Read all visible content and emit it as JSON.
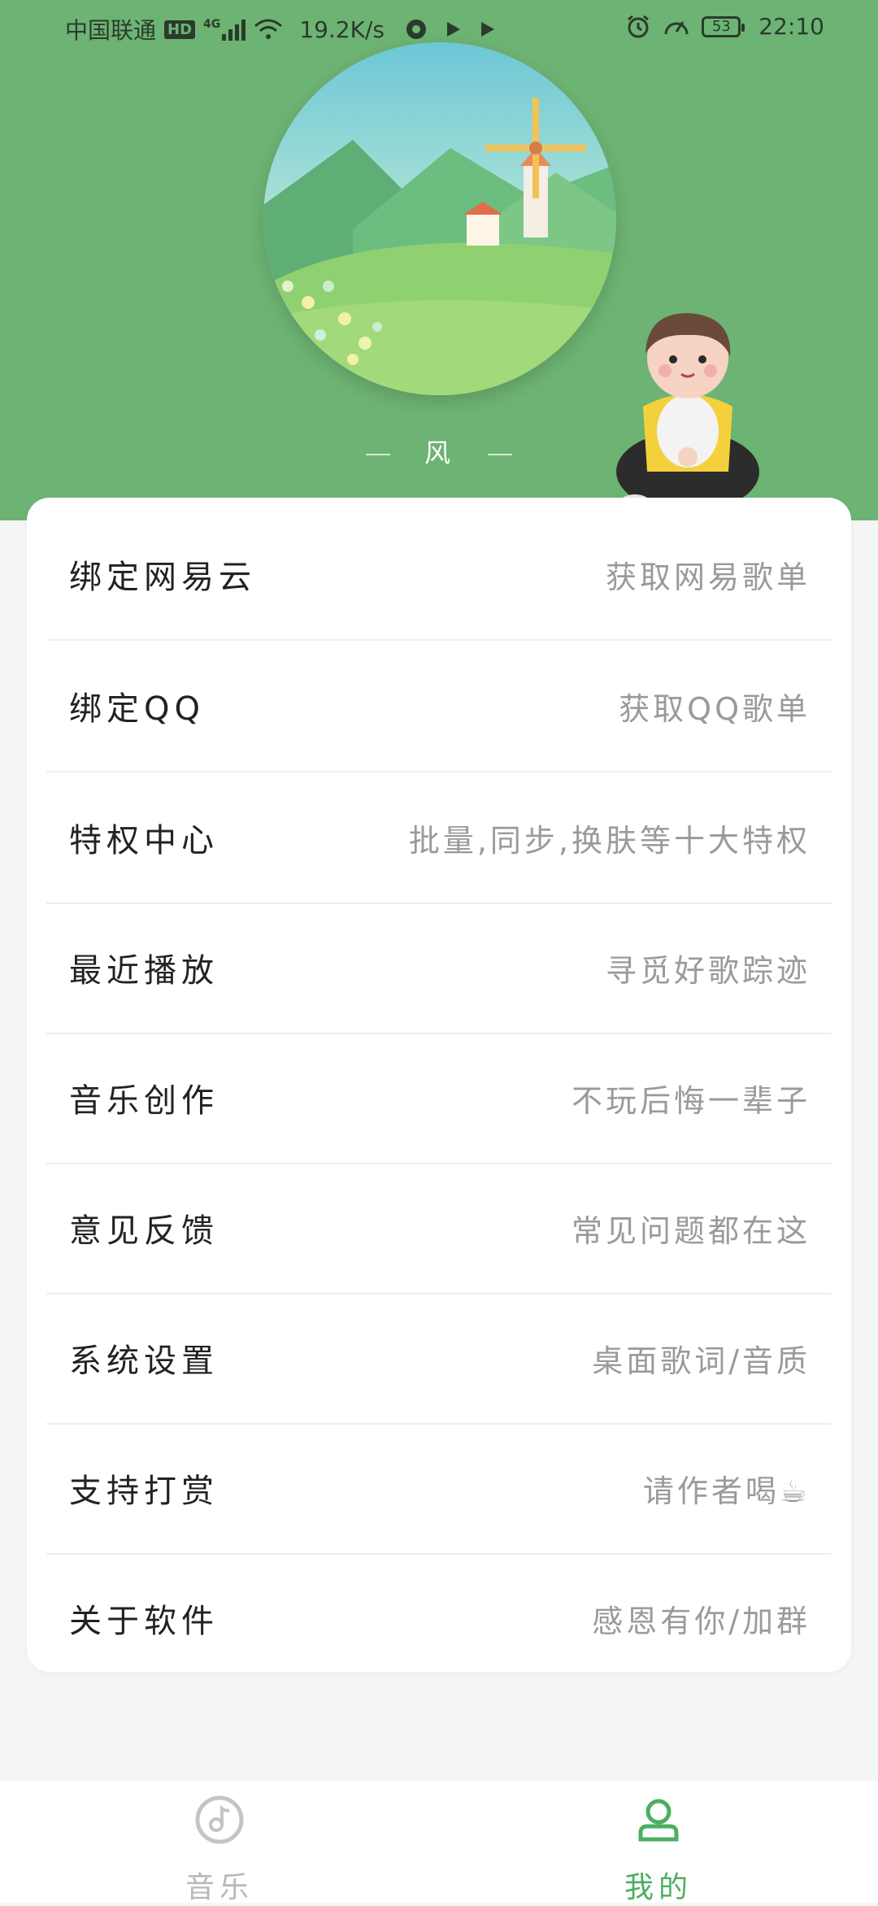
{
  "status_bar": {
    "carrier": "中国联通",
    "hd": "HD",
    "network": "4G",
    "speed": "19.2K/s",
    "battery": "53",
    "time": "22:10"
  },
  "header": {
    "title": "风",
    "accent_color": "#6db373"
  },
  "menu": [
    {
      "label": "绑定网易云",
      "desc": "获取网易歌单"
    },
    {
      "label": "绑定QQ",
      "desc": "获取QQ歌单"
    },
    {
      "label": "特权中心",
      "desc": "批量,同步,换肤等十大特权"
    },
    {
      "label": "最近播放",
      "desc": "寻觅好歌踪迹"
    },
    {
      "label": "音乐创作",
      "desc": "不玩后悔一辈子"
    },
    {
      "label": "意见反馈",
      "desc": "常见问题都在这"
    },
    {
      "label": "系统设置",
      "desc": "桌面歌词/音质"
    },
    {
      "label": "支持打赏",
      "desc": "请作者喝☕"
    },
    {
      "label": "关于软件",
      "desc": "感恩有你/加群"
    }
  ],
  "bottom_nav": {
    "music": {
      "label": "音乐",
      "icon": "music-disc-icon"
    },
    "mine": {
      "label": "我的",
      "icon": "user-icon",
      "active_color": "#4caf60"
    }
  }
}
